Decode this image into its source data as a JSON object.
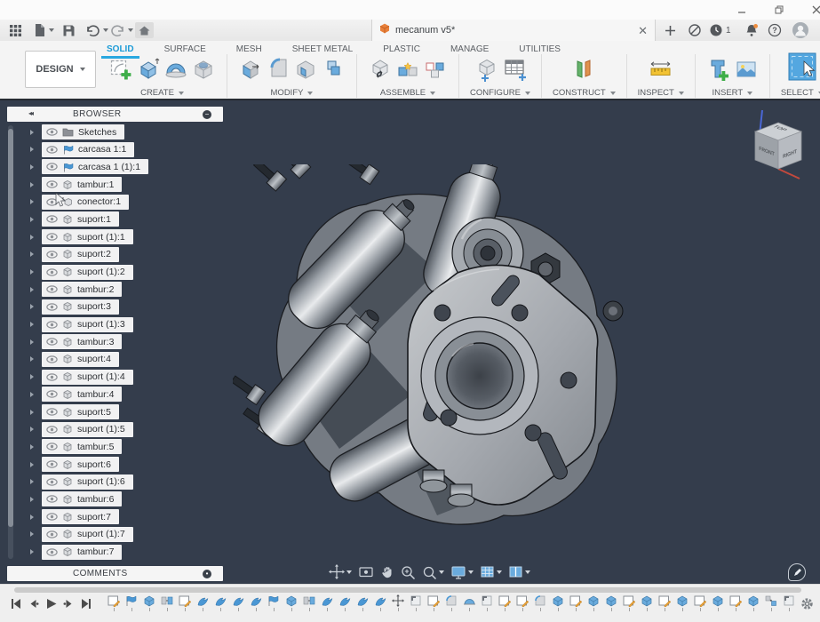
{
  "os_window": {
    "controls": [
      "minimize",
      "restore",
      "close"
    ]
  },
  "app_bar": {
    "left_tools": [
      {
        "name": "app-grid"
      },
      {
        "name": "file-menu",
        "caret": true
      },
      {
        "name": "save"
      },
      {
        "name": "undo",
        "caret": true
      },
      {
        "name": "redo",
        "caret": true
      },
      {
        "name": "home"
      }
    ],
    "document_tab": {
      "label": "mecanum v5*",
      "icon": "fusion-doc-cube"
    },
    "right_tools": [
      {
        "name": "sync-status"
      },
      {
        "name": "job-status",
        "badge": "1"
      },
      {
        "name": "notifications"
      },
      {
        "name": "help"
      },
      {
        "name": "user-avatar"
      }
    ]
  },
  "ribbon": {
    "design_menu": {
      "label": "DESIGN"
    },
    "tabs": [
      {
        "label": "SOLID",
        "active": true
      },
      {
        "label": "SURFACE",
        "active": false
      },
      {
        "label": "MESH",
        "active": false
      },
      {
        "label": "SHEET METAL",
        "active": false
      },
      {
        "label": "PLASTIC",
        "active": false
      },
      {
        "label": "MANAGE",
        "active": false
      },
      {
        "label": "UTILITIES",
        "active": false
      }
    ],
    "groups": [
      {
        "label": "CREATE",
        "icons": [
          "create-sketch",
          "extrude",
          "revolve",
          "hole"
        ]
      },
      {
        "label": "MODIFY",
        "icons": [
          "press-pull",
          "fillet",
          "shell",
          "combine"
        ]
      },
      {
        "label": "ASSEMBLE",
        "icons": [
          "new-component",
          "joint",
          "rigid-group"
        ]
      },
      {
        "label": "CONFIGURE",
        "icons": [
          "configuration",
          "configuration-table"
        ]
      },
      {
        "label": "CONSTRUCT",
        "icons": [
          "construction-plane"
        ]
      },
      {
        "label": "INSPECT",
        "icons": [
          "measure"
        ]
      },
      {
        "label": "INSERT",
        "icons": [
          "insert-derive",
          "canvas"
        ]
      },
      {
        "label": "SELECT",
        "icons": [
          "select"
        ]
      }
    ]
  },
  "browser": {
    "title": "BROWSER",
    "items": [
      {
        "label": "Sketches",
        "icon": "folder"
      },
      {
        "label": "carcasa 1:1",
        "icon": "derive"
      },
      {
        "label": "carcasa 1 (1):1",
        "icon": "derive"
      },
      {
        "label": "tambur:1",
        "icon": "body"
      },
      {
        "label": "conector:1",
        "icon": "insert"
      },
      {
        "label": "suport:1",
        "icon": "body"
      },
      {
        "label": "suport (1):1",
        "icon": "body"
      },
      {
        "label": "suport:2",
        "icon": "body"
      },
      {
        "label": "suport (1):2",
        "icon": "body"
      },
      {
        "label": "tambur:2",
        "icon": "body"
      },
      {
        "label": "suport:3",
        "icon": "body"
      },
      {
        "label": "suport (1):3",
        "icon": "body"
      },
      {
        "label": "tambur:3",
        "icon": "body"
      },
      {
        "label": "suport:4",
        "icon": "body"
      },
      {
        "label": "suport (1):4",
        "icon": "body"
      },
      {
        "label": "tambur:4",
        "icon": "body"
      },
      {
        "label": "suport:5",
        "icon": "body"
      },
      {
        "label": "suport (1):5",
        "icon": "body"
      },
      {
        "label": "tambur:5",
        "icon": "body"
      },
      {
        "label": "suport:6",
        "icon": "body"
      },
      {
        "label": "suport (1):6",
        "icon": "body"
      },
      {
        "label": "tambur:6",
        "icon": "body"
      },
      {
        "label": "suport:7",
        "icon": "body"
      },
      {
        "label": "suport (1):7",
        "icon": "body"
      },
      {
        "label": "tambur:7",
        "icon": "body"
      }
    ]
  },
  "comments": {
    "title": "COMMENTS"
  },
  "viewcube": {
    "faces": {
      "top": "TOP",
      "front": "FRONT",
      "right": "RIGHT"
    }
  },
  "nav_bar": {
    "tools": [
      {
        "name": "orbit",
        "caret": true
      },
      {
        "name": "look-at",
        "caret": false
      },
      {
        "name": "pan",
        "caret": false
      },
      {
        "name": "zoom",
        "caret": false
      },
      {
        "name": "fit",
        "caret": true
      },
      {
        "name": "display-settings",
        "caret": true
      },
      {
        "name": "grid-snap",
        "caret": true
      },
      {
        "name": "viewports",
        "caret": true
      }
    ]
  },
  "timeline": {
    "playback": [
      "go-to-start",
      "step-back",
      "play",
      "step-forward",
      "go-to-end"
    ],
    "features": [
      "sketch",
      "derive",
      "extrude",
      "joint",
      "sketch",
      "jointb",
      "jointb",
      "jointb",
      "jointb",
      "derive",
      "extrude",
      "joint",
      "jointb",
      "jointb",
      "jointb",
      "jointb",
      "move",
      "plane",
      "sketch",
      "fillet",
      "revolve",
      "plane",
      "sketch",
      "sketch",
      "fillet",
      "extrude",
      "sketch",
      "extrude",
      "extrude",
      "sketch",
      "extrude",
      "sketch",
      "extrude",
      "sketch",
      "extrude",
      "sketch",
      "extrude",
      "align",
      "plane"
    ],
    "options_icon": "gear"
  },
  "colors": {
    "viewport_bg": "#343d4c",
    "accent_blue": "#1b9bd7",
    "icon_blue": "#5ba3d9",
    "fusion_orange": "#e8762d"
  }
}
